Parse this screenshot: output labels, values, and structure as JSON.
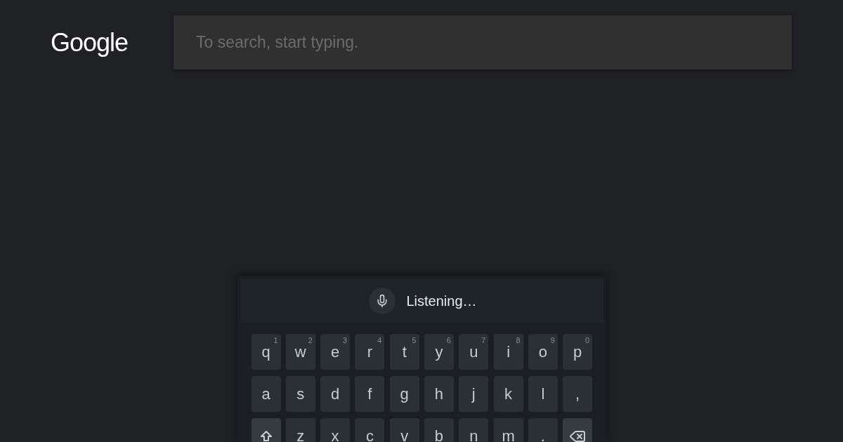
{
  "logo": {
    "text": "Google"
  },
  "search": {
    "placeholder": "To search, start typing."
  },
  "voice_bar": {
    "status": "Listening…"
  },
  "keyboard": {
    "rows": [
      {
        "keys": [
          {
            "kind": "letter",
            "label": "q",
            "hint": "1"
          },
          {
            "kind": "letter",
            "label": "w",
            "hint": "2"
          },
          {
            "kind": "letter",
            "label": "e",
            "hint": "3"
          },
          {
            "kind": "letter",
            "label": "r",
            "hint": "4"
          },
          {
            "kind": "letter",
            "label": "t",
            "hint": "5"
          },
          {
            "kind": "letter",
            "label": "y",
            "hint": "6"
          },
          {
            "kind": "letter",
            "label": "u",
            "hint": "7"
          },
          {
            "kind": "letter",
            "label": "i",
            "hint": "8"
          },
          {
            "kind": "letter",
            "label": "o",
            "hint": "9"
          },
          {
            "kind": "letter",
            "label": "p",
            "hint": "0"
          }
        ]
      },
      {
        "keys": [
          {
            "kind": "letter",
            "label": "a"
          },
          {
            "kind": "letter",
            "label": "s"
          },
          {
            "kind": "letter",
            "label": "d"
          },
          {
            "kind": "letter",
            "label": "f"
          },
          {
            "kind": "letter",
            "label": "g"
          },
          {
            "kind": "letter",
            "label": "h"
          },
          {
            "kind": "letter",
            "label": "j"
          },
          {
            "kind": "letter",
            "label": "k"
          },
          {
            "kind": "letter",
            "label": "l"
          },
          {
            "kind": "letter",
            "label": ","
          }
        ]
      },
      {
        "keys": [
          {
            "kind": "shift"
          },
          {
            "kind": "letter",
            "label": "z"
          },
          {
            "kind": "letter",
            "label": "x"
          },
          {
            "kind": "letter",
            "label": "c"
          },
          {
            "kind": "letter",
            "label": "v"
          },
          {
            "kind": "letter",
            "label": "b"
          },
          {
            "kind": "letter",
            "label": "n"
          },
          {
            "kind": "letter",
            "label": "m"
          },
          {
            "kind": "letter",
            "label": "."
          },
          {
            "kind": "backspace"
          }
        ]
      }
    ]
  }
}
